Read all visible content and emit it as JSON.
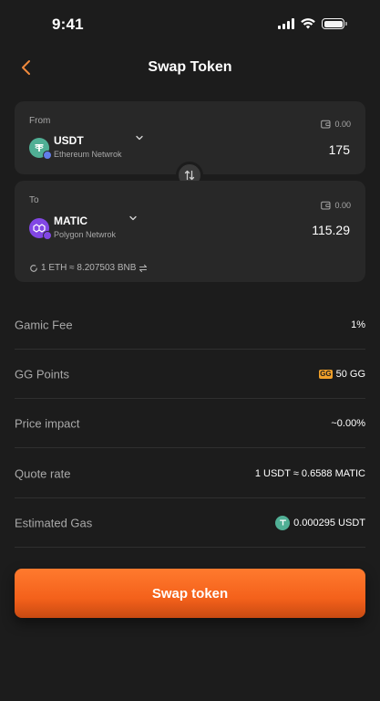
{
  "status_bar": {
    "time": "9:41"
  },
  "header": {
    "title": "Swap Token"
  },
  "from_card": {
    "label": "From",
    "token": "USDT",
    "network": "Ethereum Netwrok",
    "balance": "0.00",
    "amount": "175"
  },
  "to_card": {
    "label": "To",
    "token": "MATIC",
    "network": "Polygon Netwrok",
    "balance": "0.00",
    "amount": "115.29",
    "rate": "1 ETH ≈ 8.207503 BNB"
  },
  "info": {
    "fee_label": "Gamic Fee",
    "fee_value": "1%",
    "points_label": "GG Points",
    "points_icon_text": "GG",
    "points_value": "50 GG",
    "impact_label": "Price impact",
    "impact_value": "~0.00%",
    "quote_label": "Quote rate",
    "quote_value": "1 USDT ≈ 0.6588 MATIC",
    "gas_label": "Estimated Gas",
    "gas_value": "0.000295 USDT"
  },
  "cta": {
    "label": "Swap token"
  },
  "colors": {
    "background": "#1c1c1c",
    "card": "#282828",
    "accent": "#ff6a20",
    "usdt": "#50af95",
    "matic": "#8247e5"
  },
  "icons": [
    "back-arrow-icon",
    "wallet-icon",
    "chevron-down-icon",
    "swap-direction-icon",
    "refresh-icon",
    "exchange-icon",
    "usdt-icon",
    "matic-icon",
    "gg-points-icon"
  ]
}
